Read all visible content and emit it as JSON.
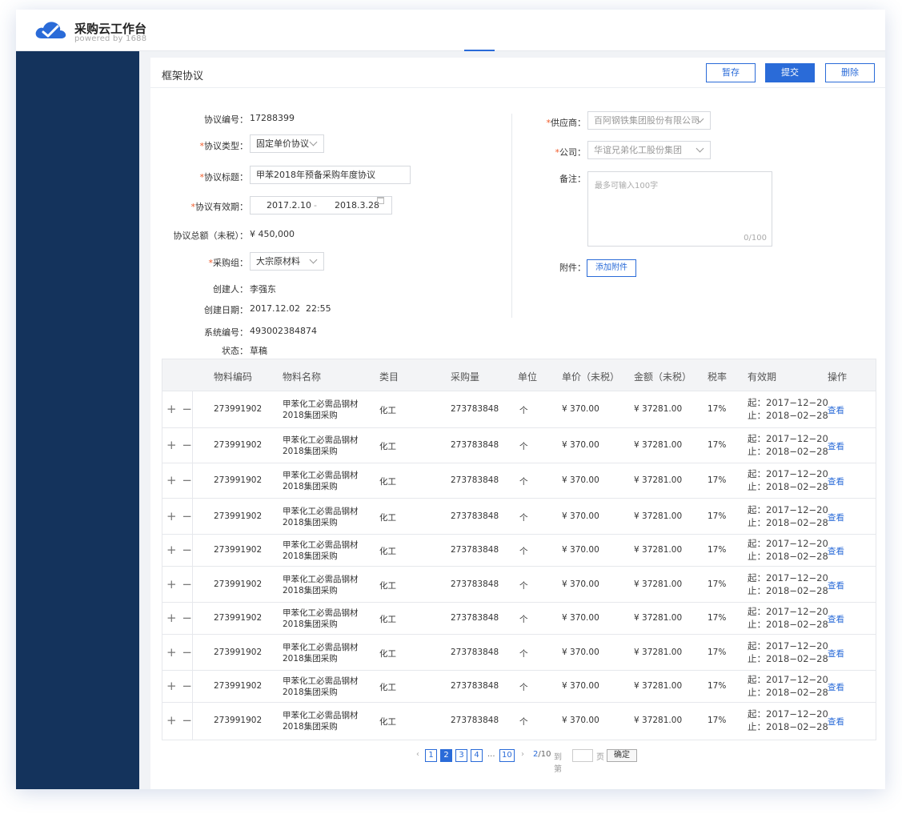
{
  "app": {
    "name": "采购云工作台",
    "subtitle": "powered by 1688"
  },
  "page": {
    "title": "框架协议",
    "buttons": {
      "save": "暂存",
      "submit": "提交",
      "delete": "删除"
    }
  },
  "form": {
    "agreement_no": {
      "label": "协议编号：",
      "value": "17288399"
    },
    "agreement_type": {
      "label": "协议类型：",
      "value": "固定单价协议"
    },
    "agreement_title": {
      "label": "协议标题：",
      "value": "甲苯2018年预备采购年度协议"
    },
    "validity": {
      "label": "协议有效期：",
      "start": "2017.2.10",
      "sep": "-",
      "end": "2018.3.28"
    },
    "total_amount": {
      "label": "协议总额（未税）：",
      "value": "¥ 450,000"
    },
    "purchase_group": {
      "label": "采购组：",
      "value": "大宗原材料"
    },
    "creator": {
      "label": "创建人：",
      "value": "李强东"
    },
    "created_date": {
      "label": "创建日期：",
      "value": "2017.12.02  22:55"
    },
    "system_no": {
      "label": "系统编号：",
      "value": "493002384874"
    },
    "status": {
      "label": "状态：",
      "value": "草稿"
    },
    "supplier": {
      "label": "供应商：",
      "value": "百阿钢铁集团股份有限公司"
    },
    "company": {
      "label": "公司：",
      "value": "华谊兄弟化工股份集团"
    },
    "remark": {
      "label": "备注：",
      "placeholder": "最多可输入100字",
      "counter": "0/100"
    },
    "attachment": {
      "label": "附件：",
      "button": "添加附件"
    },
    "required_mark": "*"
  },
  "table": {
    "columns": [
      "物料编码",
      "物料名称",
      "类目",
      "采购量",
      "单位",
      "单价（未税）",
      "金额（未税）",
      "税率",
      "有效期",
      "操作"
    ],
    "plus_minus": "+ −",
    "rows": [
      {
        "code": "273991902",
        "name1": "甲苯化工必需品钢材",
        "name2": "2018集团采购",
        "category": "化工",
        "qty": "273783848",
        "unit": "个",
        "price": "¥ 370.00",
        "amount": "¥ 37281.00",
        "tax": "17%",
        "start": "起：2017−12−20",
        "end": "止：2018−02−28",
        "action": "查看"
      },
      {
        "code": "273991902",
        "name1": "甲苯化工必需品钢材",
        "name2": "2018集团采购",
        "category": "化工",
        "qty": "273783848",
        "unit": "个",
        "price": "¥ 370.00",
        "amount": "¥ 37281.00",
        "tax": "17%",
        "start": "起：2017−12−20",
        "end": "止：2018−02−28",
        "action": "查看"
      },
      {
        "code": "273991902",
        "name1": "甲苯化工必需品钢材",
        "name2": "2018集团采购",
        "category": "化工",
        "qty": "273783848",
        "unit": "个",
        "price": "¥ 370.00",
        "amount": "¥ 37281.00",
        "tax": "17%",
        "start": "起：2017−12−20",
        "end": "止：2018−02−28",
        "action": "查看"
      },
      {
        "code": "273991902",
        "name1": "甲苯化工必需品钢材",
        "name2": "2018集团采购",
        "category": "化工",
        "qty": "273783848",
        "unit": "个",
        "price": "¥ 370.00",
        "amount": "¥ 37281.00",
        "tax": "17%",
        "start": "起：2017−12−20",
        "end": "止：2018−02−28",
        "action": "查看"
      },
      {
        "code": "273991902",
        "name1": "甲苯化工必需品钢材",
        "name2": "2018集团采购",
        "category": "化工",
        "qty": "273783848",
        "unit": "个",
        "price": "¥ 370.00",
        "amount": "¥ 37281.00",
        "tax": "17%",
        "start": "起：2017−12−20",
        "end": "止：2018−02−28",
        "action": "查看"
      },
      {
        "code": "273991902",
        "name1": "甲苯化工必需品钢材",
        "name2": "2018集团采购",
        "category": "化工",
        "qty": "273783848",
        "unit": "个",
        "price": "¥ 370.00",
        "amount": "¥ 37281.00",
        "tax": "17%",
        "start": "起：2017−12−20",
        "end": "止：2018−02−28",
        "action": "查看"
      },
      {
        "code": "273991902",
        "name1": "甲苯化工必需品钢材",
        "name2": "2018集团采购",
        "category": "化工",
        "qty": "273783848",
        "unit": "个",
        "price": "¥ 370.00",
        "amount": "¥ 37281.00",
        "tax": "17%",
        "start": "起：2017−12−20",
        "end": "止：2018−02−28",
        "action": "查看"
      },
      {
        "code": "273991902",
        "name1": "甲苯化工必需品钢材",
        "name2": "2018集团采购",
        "category": "化工",
        "qty": "273783848",
        "unit": "个",
        "price": "¥ 370.00",
        "amount": "¥ 37281.00",
        "tax": "17%",
        "start": "起：2017−12−20",
        "end": "止：2018−02−28",
        "action": "查看"
      },
      {
        "code": "273991902",
        "name1": "甲苯化工必需品钢材",
        "name2": "2018集团采购",
        "category": "化工",
        "qty": "273783848",
        "unit": "个",
        "price": "¥ 370.00",
        "amount": "¥ 37281.00",
        "tax": "17%",
        "start": "起：2017−12−20",
        "end": "止：2018−02−28",
        "action": "查看"
      },
      {
        "code": "273991902",
        "name1": "甲苯化工必需品钢材",
        "name2": "2018集团采购",
        "category": "化工",
        "qty": "273783848",
        "unit": "个",
        "price": "¥ 370.00",
        "amount": "¥ 37281.00",
        "tax": "17%",
        "start": "起：2017−12−20",
        "end": "止：2018−02−28",
        "action": "查看"
      }
    ]
  },
  "pager": {
    "prev": "‹",
    "pages": [
      "1",
      "2",
      "3",
      "4"
    ],
    "ellipsis": "...",
    "last": "10",
    "next": "›",
    "current": "2",
    "total": "/10",
    "goto_label": "到第",
    "page_unit": "页",
    "confirm": "确定"
  },
  "colors": {
    "sidebar": "#14335c",
    "accent": "#2a6bd8",
    "required": "#f05a28"
  }
}
